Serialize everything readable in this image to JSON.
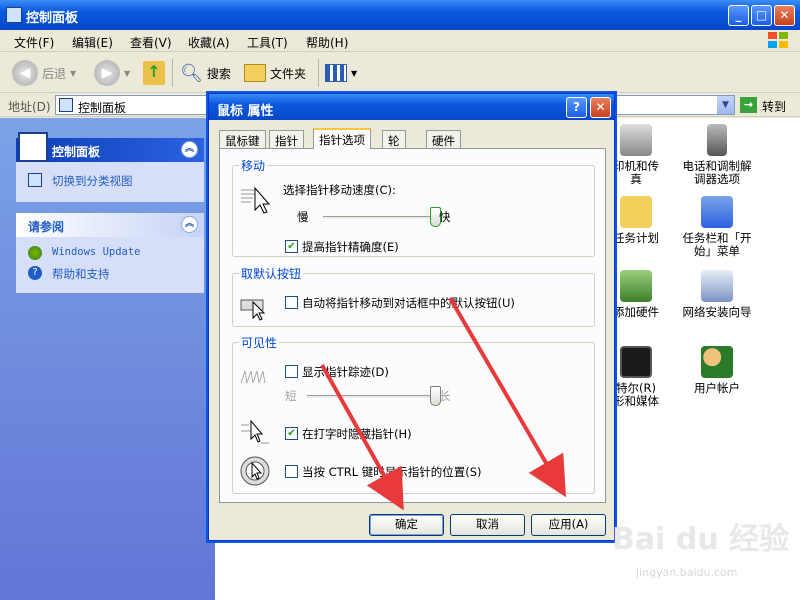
{
  "window": {
    "title": "控制面板"
  },
  "menu": [
    "文件(F)",
    "编辑(E)",
    "查看(V)",
    "收藏(A)",
    "工具(T)",
    "帮助(H)"
  ],
  "toolbar": {
    "back": "后退",
    "search": "搜索",
    "folders": "文件夹"
  },
  "address": {
    "label": "地址(D)",
    "value": "控制面板",
    "go": "转到"
  },
  "left_panel": {
    "main_title": "控制面板",
    "switch_view": "切换到分类视图",
    "see_also_title": "请参阅",
    "links": [
      "Windows Update",
      "帮助和支持"
    ]
  },
  "content_items": [
    "印机和传真",
    "电话和调制解调器选项",
    "任务计划",
    "任务栏和「开始」菜单",
    "添加硬件",
    "网络安装向导",
    "特尔(R)形和媒体",
    "用户帐户"
  ],
  "dialog": {
    "title": "鼠标 属性",
    "help_btn": "?",
    "tabs": [
      "鼠标键",
      "指针",
      "指针选项",
      "轮",
      "硬件"
    ],
    "active_tab": 2,
    "motion": {
      "legend": "移动",
      "speed_label": "选择指针移动速度(C):",
      "slow": "慢",
      "fast": "快",
      "speed_value": 1.0,
      "precision_label": "提高指针精确度(E)",
      "precision_checked": true
    },
    "snap": {
      "legend": "取默认按钮",
      "label": "自动将指针移动到对话框中的默认按钮(U)",
      "checked": false
    },
    "visibility": {
      "legend": "可见性",
      "trails_label": "显示指针踪迹(D)",
      "trails_checked": false,
      "short": "短",
      "long": "长",
      "trail_value": 1.0,
      "hide_label": "在打字时隐藏指针(H)",
      "hide_checked": true,
      "ctrl_label": "当按 CTRL 键时显示指针的位置(S)",
      "ctrl_checked": false
    },
    "buttons": {
      "ok": "确定",
      "cancel": "取消",
      "apply": "应用(A)"
    }
  },
  "watermark": {
    "brand": "Bai du 经验",
    "url": "jingyan.baidu.com"
  },
  "colors": {
    "xp_blue": "#0a58e0",
    "annotation_red": "#e83a3a",
    "legend_blue": "#0046d5"
  }
}
